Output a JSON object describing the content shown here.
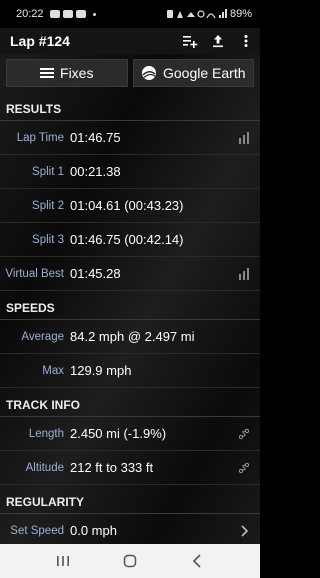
{
  "status_bar": {
    "time": "20:22",
    "battery": "89%"
  },
  "app_bar": {
    "title": "Lap #124"
  },
  "buttons": {
    "fixes": "Fixes",
    "google_earth": "Google Earth"
  },
  "sections": {
    "results": "RESULTS",
    "speeds": "SPEEDS",
    "track_info": "TRACK INFO",
    "regularity": "REGULARITY"
  },
  "results": [
    {
      "label": "Lap Time",
      "value": "01:46.75"
    },
    {
      "label": "Split 1",
      "value": "00:21.38"
    },
    {
      "label": "Split 2",
      "value": "01:04.61 (00:43.23)"
    },
    {
      "label": "Split 3",
      "value": "01:46.75 (00:42.14)"
    },
    {
      "label": "Virtual Best",
      "value": "01:45.28"
    }
  ],
  "speeds": [
    {
      "label": "Average",
      "value": "84.2 mph @ 2.497 mi"
    },
    {
      "label": "Max",
      "value": "129.9 mph"
    }
  ],
  "track_info": [
    {
      "label": "Length",
      "value": "2.450 mi (-1.9%)"
    },
    {
      "label": "Altitude",
      "value": "212 ft to 333 ft"
    }
  ],
  "regularity": [
    {
      "label": "Set Speed",
      "value": "0.0 mph"
    }
  ],
  "icons": {
    "chart": "bar-chart-icon",
    "track": "track-path-icon",
    "chevron": "chevron-right-icon"
  }
}
